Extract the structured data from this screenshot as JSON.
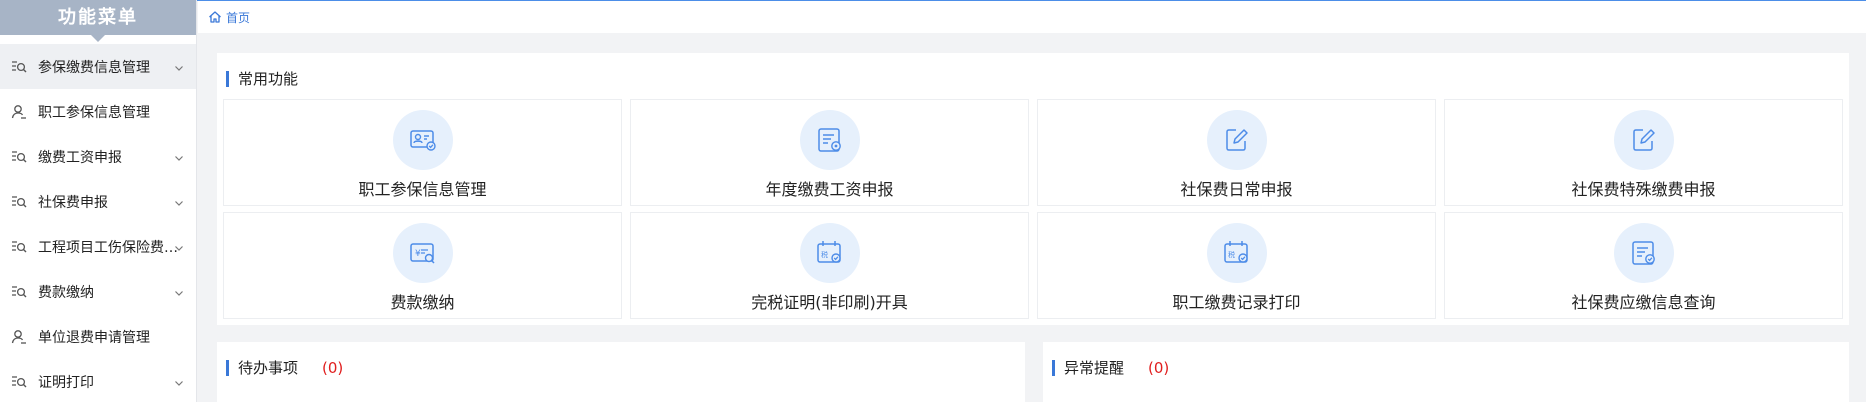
{
  "sidebar": {
    "title": "功能菜单",
    "items": [
      {
        "label": "参保缴费信息管理",
        "icon": "search-list-icon",
        "expandable": true,
        "active": true
      },
      {
        "label": "职工参保信息管理",
        "icon": "user-icon",
        "expandable": false,
        "active": false
      },
      {
        "label": "缴费工资申报",
        "icon": "search-list-icon",
        "expandable": true,
        "active": false
      },
      {
        "label": "社保费申报",
        "icon": "search-list-icon",
        "expandable": true,
        "active": false
      },
      {
        "label": "工程项目工伤保险费…",
        "icon": "search-list-icon",
        "expandable": true,
        "active": false
      },
      {
        "label": "费款缴纳",
        "icon": "search-list-icon",
        "expandable": true,
        "active": false
      },
      {
        "label": "单位退费申请管理",
        "icon": "user-icon",
        "expandable": false,
        "active": false
      },
      {
        "label": "证明打印",
        "icon": "search-list-icon",
        "expandable": true,
        "active": false
      }
    ]
  },
  "breadcrumb": {
    "home": "首页",
    "icon": "home-icon"
  },
  "common_functions": {
    "title": "常用功能",
    "tiles": [
      {
        "label": "职工参保信息管理",
        "icon": "id-card-check-icon"
      },
      {
        "label": "年度缴费工资申报",
        "icon": "document-seal-icon"
      },
      {
        "label": "社保费日常申报",
        "icon": "edit-icon"
      },
      {
        "label": "社保费特殊缴费申报",
        "icon": "edit-icon"
      },
      {
        "label": "费款缴纳",
        "icon": "yuan-search-icon"
      },
      {
        "label": "完税证明(非印刷)开具",
        "icon": "tax-calendar-check-icon"
      },
      {
        "label": "职工缴费记录打印",
        "icon": "tax-calendar-check-icon"
      },
      {
        "label": "社保费应缴信息查询",
        "icon": "document-check-icon"
      }
    ]
  },
  "todo": {
    "title": "待办事项",
    "count": "(0)"
  },
  "alert": {
    "title": "异常提醒",
    "count": "(0)"
  },
  "colors": {
    "accent": "#3a78d8",
    "sidebar_header": "#a7b4c6",
    "count_red": "#e01e1e",
    "icon_bg": "#e6f0fc"
  }
}
